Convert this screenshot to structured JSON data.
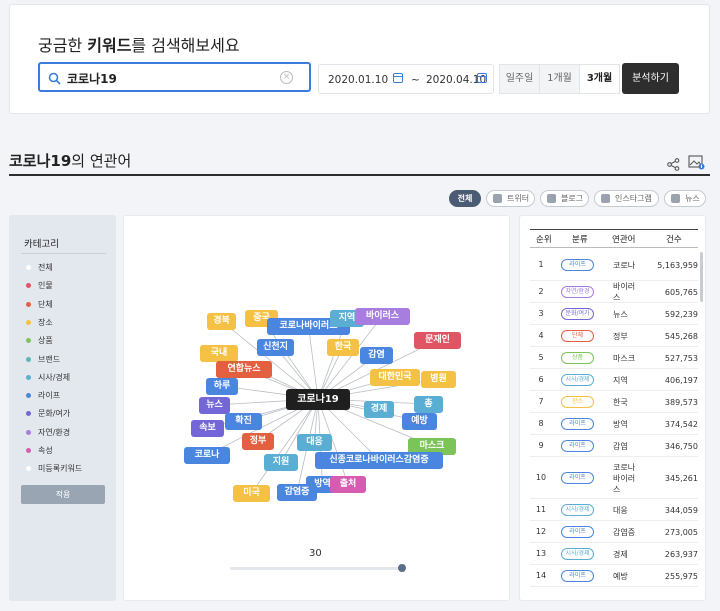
{
  "search": {
    "title_prefix": "궁금한 ",
    "title_bold": "키워드",
    "title_suffix": "를 검색해보세요",
    "query": "코로나19",
    "date_start": "2020.01.10",
    "date_sep": "~",
    "date_end": "2020.04.10",
    "periods": [
      "일주일",
      "1개월",
      "3개월"
    ],
    "active_period": "3개월",
    "analyze_label": "분석하기"
  },
  "section": {
    "keyword": "코로나19",
    "title_suffix": "의 연관어"
  },
  "filters": [
    {
      "label": "전체",
      "active": true
    },
    {
      "label": "트위터",
      "active": false
    },
    {
      "label": "블로그",
      "active": false
    },
    {
      "label": "인스타그램",
      "active": false
    },
    {
      "label": "뉴스",
      "active": false
    }
  ],
  "categories": {
    "title": "카테고리",
    "items": [
      {
        "label": "전체",
        "color": "#ffffff"
      },
      {
        "label": "인물",
        "color": "#e05563"
      },
      {
        "label": "단체",
        "color": "#e2603f"
      },
      {
        "label": "장소",
        "color": "#f5c144"
      },
      {
        "label": "상품",
        "color": "#7cc35a"
      },
      {
        "label": "브랜드",
        "color": "#5cb8b2"
      },
      {
        "label": "시사/경제",
        "color": "#5aaed4"
      },
      {
        "label": "라이프",
        "color": "#4a86e0"
      },
      {
        "label": "문화/여가",
        "color": "#7367d8"
      },
      {
        "label": "자연/환경",
        "color": "#a77ee0"
      },
      {
        "label": "속성",
        "color": "#d55cb0"
      },
      {
        "label": "미등록키워드",
        "color": "#ffffff"
      }
    ],
    "apply_label": "적용"
  },
  "graph": {
    "center": "코로나19",
    "nodes": [
      {
        "label": "경북",
        "color": "#f5c144"
      },
      {
        "label": "중국",
        "color": "#f5c144"
      },
      {
        "label": "코로나바이러스",
        "color": "#4a86e0"
      },
      {
        "label": "지역",
        "color": "#5aaed4"
      },
      {
        "label": "바이러스",
        "color": "#a77ee0"
      },
      {
        "label": "신천지",
        "color": "#4a86e0"
      },
      {
        "label": "한국",
        "color": "#f5c144"
      },
      {
        "label": "문재인",
        "color": "#e05563"
      },
      {
        "label": "국내",
        "color": "#f5c144"
      },
      {
        "label": "감염",
        "color": "#4a86e0"
      },
      {
        "label": "연합뉴스",
        "color": "#e2603f"
      },
      {
        "label": "대한민국",
        "color": "#f5c144"
      },
      {
        "label": "병원",
        "color": "#f5c144"
      },
      {
        "label": "하루",
        "color": "#4a86e0"
      },
      {
        "label": "뉴스",
        "color": "#7367d8"
      },
      {
        "label": "경제",
        "color": "#5aaed4"
      },
      {
        "label": "총",
        "color": "#5aaed4"
      },
      {
        "label": "확진",
        "color": "#4a86e0"
      },
      {
        "label": "예방",
        "color": "#4a86e0"
      },
      {
        "label": "속보",
        "color": "#7367d8"
      },
      {
        "label": "정부",
        "color": "#e2603f"
      },
      {
        "label": "대응",
        "color": "#5aaed4"
      },
      {
        "label": "마스크",
        "color": "#7cc35a"
      },
      {
        "label": "코로나",
        "color": "#4a86e0"
      },
      {
        "label": "지원",
        "color": "#5aaed4"
      },
      {
        "label": "신종코로나바이러스감염증",
        "color": "#4a86e0"
      },
      {
        "label": "방역",
        "color": "#4a86e0"
      },
      {
        "label": "출처",
        "color": "#d55cb0"
      },
      {
        "label": "미국",
        "color": "#f5c144"
      },
      {
        "label": "감염증",
        "color": "#4a86e0"
      }
    ],
    "slider_value": "30",
    "slider_fraction": 1.0
  },
  "table": {
    "headers": [
      "순위",
      "분류",
      "연관어",
      "건수"
    ],
    "rows": [
      {
        "rank": "1",
        "cat": "라이프",
        "color": "#4a86e0",
        "word": "코로나",
        "count": "5,163,959"
      },
      {
        "rank": "2",
        "cat": "자연/환경",
        "color": "#a77ee0",
        "word": "바이러스",
        "count": "605,765"
      },
      {
        "rank": "3",
        "cat": "문화/여가",
        "color": "#7367d8",
        "word": "뉴스",
        "count": "592,239"
      },
      {
        "rank": "4",
        "cat": "단체",
        "color": "#e2603f",
        "word": "정부",
        "count": "545,268"
      },
      {
        "rank": "5",
        "cat": "상품",
        "color": "#7cc35a",
        "word": "마스크",
        "count": "527,753"
      },
      {
        "rank": "6",
        "cat": "시사/경제",
        "color": "#5aaed4",
        "word": "지역",
        "count": "406,197"
      },
      {
        "rank": "7",
        "cat": "장소",
        "color": "#f5c144",
        "word": "한국",
        "count": "389,573"
      },
      {
        "rank": "8",
        "cat": "라이프",
        "color": "#4a86e0",
        "word": "방역",
        "count": "374,542"
      },
      {
        "rank": "9",
        "cat": "라이프",
        "color": "#4a86e0",
        "word": "감염",
        "count": "346,750"
      },
      {
        "rank": "10",
        "cat": "라이프",
        "color": "#4a86e0",
        "word": "코로나바이러스",
        "count": "345,261"
      },
      {
        "rank": "11",
        "cat": "시사/경제",
        "color": "#5aaed4",
        "word": "대응",
        "count": "344,059"
      },
      {
        "rank": "12",
        "cat": "라이프",
        "color": "#4a86e0",
        "word": "감염증",
        "count": "273,005"
      },
      {
        "rank": "13",
        "cat": "시사/경제",
        "color": "#5aaed4",
        "word": "경제",
        "count": "263,937"
      },
      {
        "rank": "14",
        "cat": "라이프",
        "color": "#4a86e0",
        "word": "예방",
        "count": "255,975"
      }
    ]
  }
}
